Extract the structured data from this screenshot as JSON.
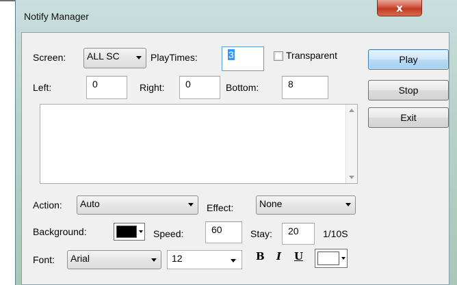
{
  "window": {
    "title": "Notify Manager",
    "close_glyph": "x"
  },
  "screen": {
    "label": "Screen:",
    "value": "ALL SC"
  },
  "playtimes": {
    "label": "PlayTimes:",
    "value": "3"
  },
  "transparent": {
    "label": "Transparent",
    "checked": false
  },
  "left": {
    "label": "Left:",
    "value": "0"
  },
  "right": {
    "label": "Right:",
    "value": "0"
  },
  "bottom": {
    "label": "Bottom:",
    "value": "8"
  },
  "message": {
    "value": ""
  },
  "action": {
    "label": "Action:",
    "value": "Auto"
  },
  "effect": {
    "label": "Effect:",
    "value": "None"
  },
  "background": {
    "label": "Background:",
    "color": "#000000"
  },
  "speed": {
    "label": "Speed:",
    "value": "60"
  },
  "stay": {
    "label": "Stay:",
    "value": "20",
    "unit": "1/10S"
  },
  "font": {
    "label": "Font:",
    "name": "Arial",
    "size": "12",
    "color": "#ffffff"
  },
  "format": {
    "bold": "B",
    "italic": "I",
    "underline": "U"
  },
  "buttons": {
    "play": "Play",
    "stop": "Stop",
    "exit": "Exit"
  },
  "colors": {
    "accent": "#3c7fb1",
    "close": "#c13a24",
    "frame": "#b7d3c9"
  }
}
